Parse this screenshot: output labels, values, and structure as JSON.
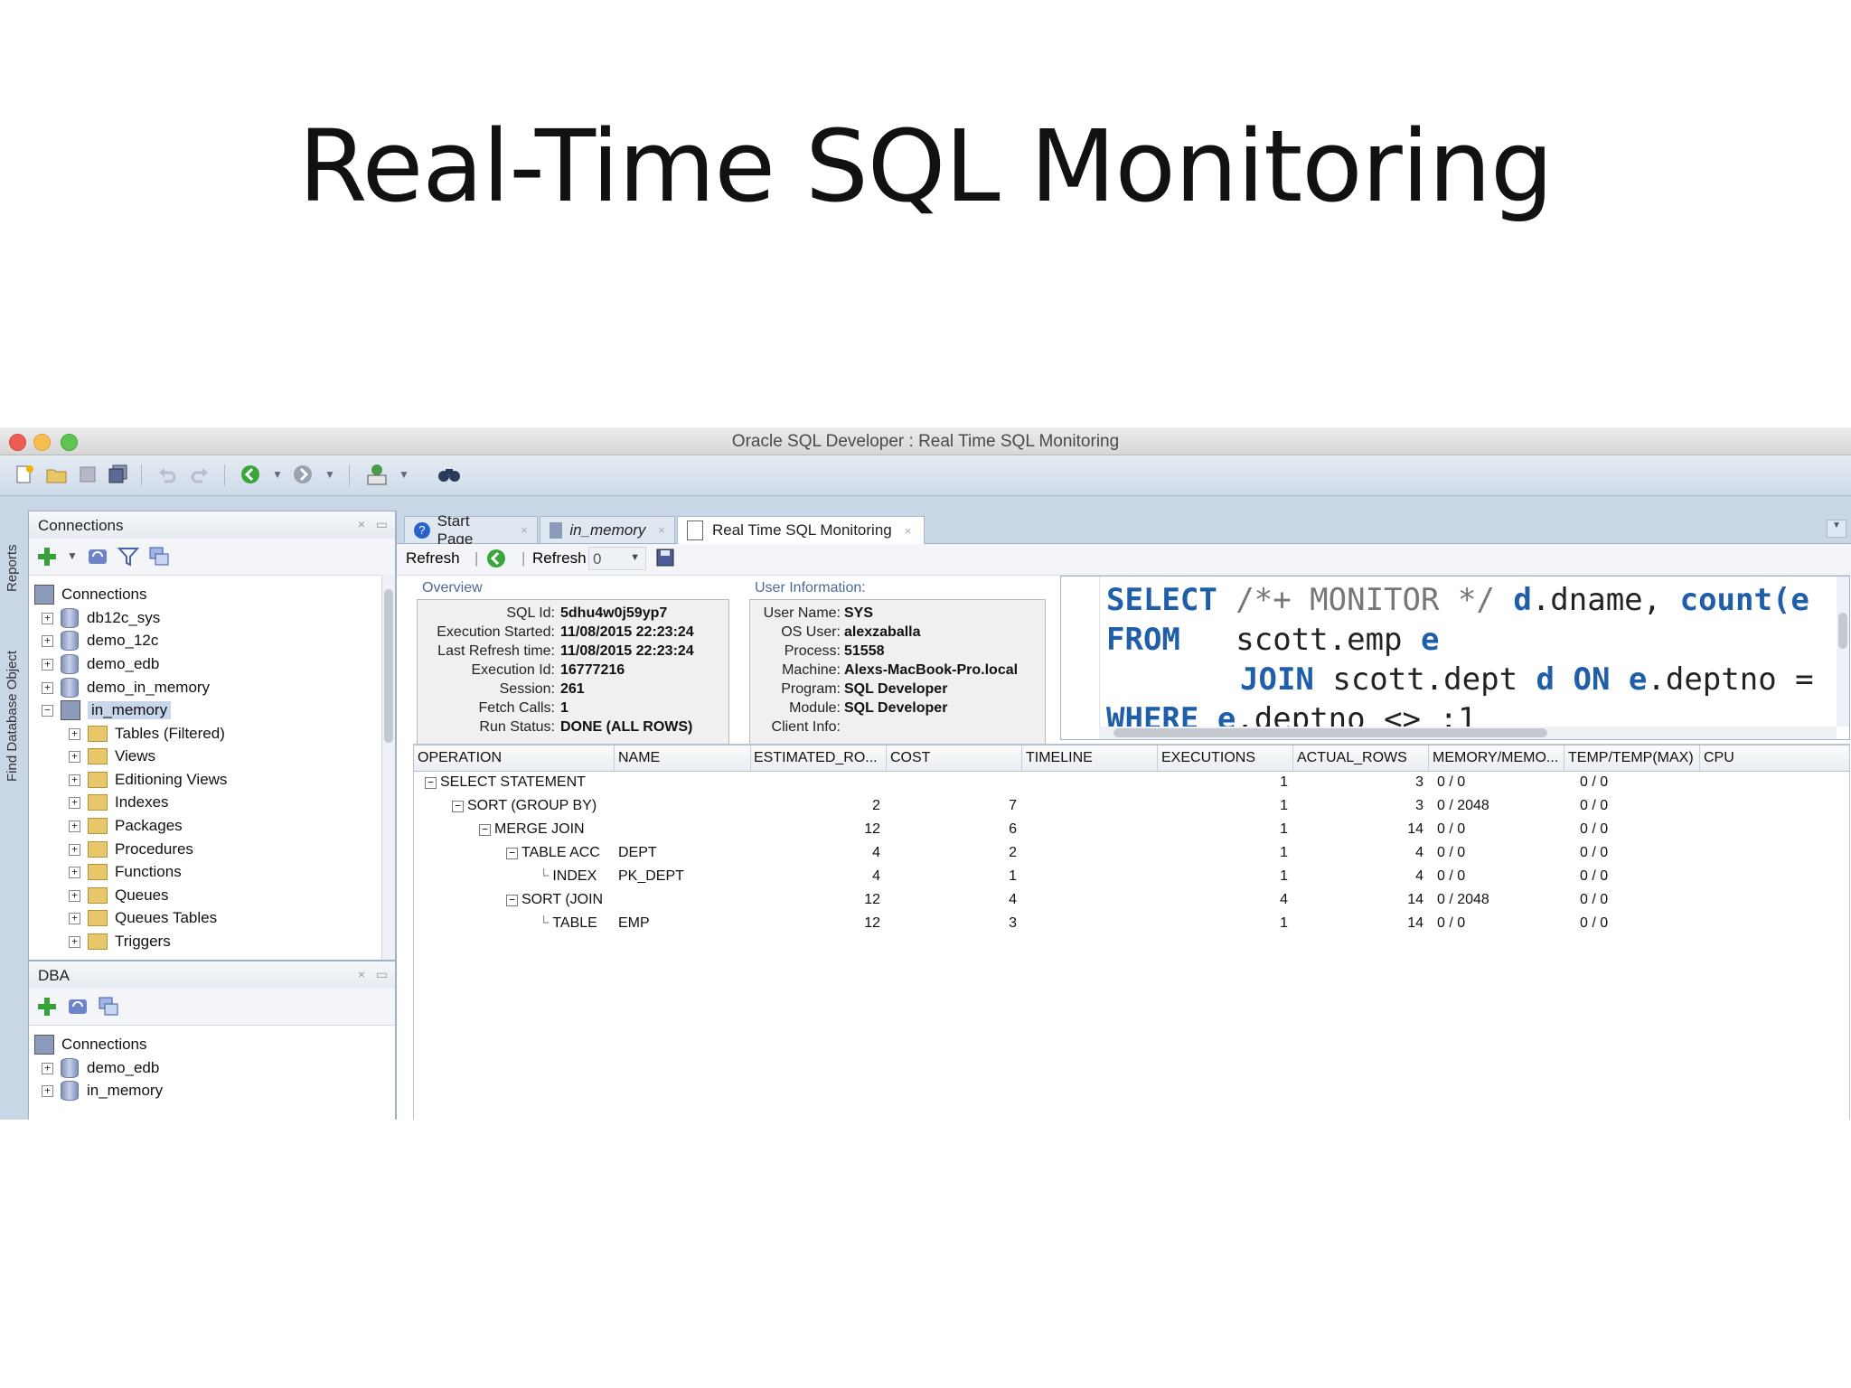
{
  "slide_title": "Real-Time SQL Monitoring",
  "window": {
    "title": "Oracle SQL Developer : Real Time SQL Monitoring"
  },
  "side_strip": {
    "reports": "Reports",
    "find_db_object": "Find Database Object"
  },
  "connections_panel": {
    "title": "Connections",
    "root": "Connections",
    "connections": [
      "db12c_sys",
      "demo_12c",
      "demo_edb",
      "demo_in_memory"
    ],
    "expanded": "in_memory",
    "children": [
      "Tables (Filtered)",
      "Views",
      "Editioning Views",
      "Indexes",
      "Packages",
      "Procedures",
      "Functions",
      "Queues",
      "Queues Tables",
      "Triggers"
    ]
  },
  "dba_panel": {
    "title": "DBA",
    "root": "Connections",
    "connections": [
      "demo_edb",
      "in_memory"
    ]
  },
  "tabs": [
    {
      "label": "Start Page",
      "active": false
    },
    {
      "label": "in_memory",
      "active": false
    },
    {
      "label": "Real Time SQL Monitoring",
      "active": true
    }
  ],
  "editor_toolbar": {
    "refresh_button": "Refresh",
    "refresh_label": "Refresh",
    "refresh_value": "0"
  },
  "overview": {
    "label": "Overview",
    "rows": [
      {
        "k": "SQL Id:",
        "v": "5dhu4w0j59yp7"
      },
      {
        "k": "Execution Started:",
        "v": "11/08/2015 22:23:24"
      },
      {
        "k": "Last Refresh time:",
        "v": "11/08/2015 22:23:24"
      },
      {
        "k": "Execution Id:",
        "v": "16777216"
      },
      {
        "k": "Session:",
        "v": "261"
      },
      {
        "k": "Fetch Calls:",
        "v": "1"
      },
      {
        "k": "Run Status:",
        "v": "DONE (ALL ROWS)"
      }
    ]
  },
  "user_info": {
    "label": "User Information:",
    "rows": [
      {
        "k": "User Name:",
        "v": "SYS"
      },
      {
        "k": "OS User:",
        "v": "alexzaballa"
      },
      {
        "k": "Process:",
        "v": "51558"
      },
      {
        "k": "Machine:",
        "v": "Alexs-MacBook-Pro.local"
      },
      {
        "k": "Program:",
        "v": "SQL Developer"
      },
      {
        "k": "Module:",
        "v": "SQL Developer"
      },
      {
        "k": "Client Info:",
        "v": ""
      }
    ]
  },
  "sql_text": {
    "l1_kw": "SELECT",
    "l1_cm": " /*+ MONITOR */ ",
    "l1_a": "d",
    "l1_rest": ".dname, ",
    "l1_kw2": "count(e",
    "l2_kw": "FROM",
    "l2_rest": "   scott.emp ",
    "l2_a": "e",
    "l3_kw": "JOIN",
    "l3_rest": " scott.dept ",
    "l3_a": "d",
    "l3_kw2": " ON ",
    "l3_a2": "e",
    "l3_rest2": ".deptno =",
    "l4_kw": "WHERE",
    "l4_a": " e",
    "l4_rest": ".deptno <> :1"
  },
  "plan_grid": {
    "columns": [
      "OPERATION",
      "NAME",
      "ESTIMATED_RO...",
      "COST",
      "TIMELINE",
      "EXECUTIONS",
      "ACTUAL_ROWS",
      "MEMORY/MEMO...",
      "TEMP/TEMP(MAX)",
      "CPU"
    ],
    "rows": [
      {
        "op": "SELECT STATEMENT",
        "name": "",
        "est": "",
        "cost": "",
        "exec": "1",
        "rows": "3",
        "mem": "0 / 0",
        "temp": "0 / 0"
      },
      {
        "op": "SORT (GROUP BY)",
        "name": "",
        "est": "2",
        "cost": "7",
        "exec": "1",
        "rows": "3",
        "mem": "0 / 2048",
        "temp": "0 / 0"
      },
      {
        "op": "MERGE JOIN",
        "name": "",
        "est": "12",
        "cost": "6",
        "exec": "1",
        "rows": "14",
        "mem": "0 / 0",
        "temp": "0 / 0"
      },
      {
        "op": "TABLE ACC",
        "name": "DEPT",
        "est": "4",
        "cost": "2",
        "exec": "1",
        "rows": "4",
        "mem": "0 / 0",
        "temp": "0 / 0"
      },
      {
        "op": "INDEX",
        "name": "PK_DEPT",
        "est": "4",
        "cost": "1",
        "exec": "1",
        "rows": "4",
        "mem": "0 / 0",
        "temp": "0 / 0"
      },
      {
        "op": "SORT (JOIN",
        "name": "",
        "est": "12",
        "cost": "4",
        "exec": "4",
        "rows": "14",
        "mem": "0 / 2048",
        "temp": "0 / 0"
      },
      {
        "op": "TABLE",
        "name": "EMP",
        "est": "12",
        "cost": "3",
        "exec": "1",
        "rows": "14",
        "mem": "0 / 0",
        "temp": "0 / 0"
      }
    ]
  },
  "colors": {
    "accent": "#1f5ea8",
    "chrome": "#c9d6e6"
  }
}
